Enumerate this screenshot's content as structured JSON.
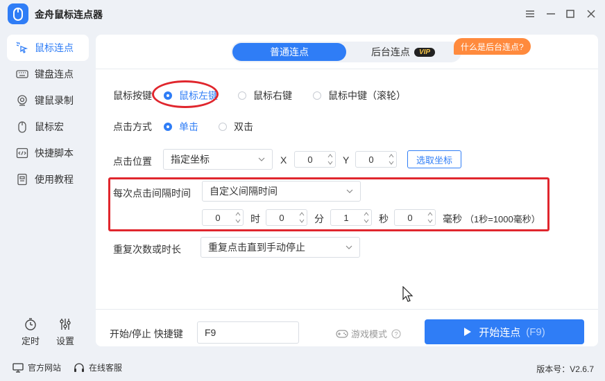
{
  "window": {
    "title": "金舟鼠标连点器",
    "controls": [
      "menu",
      "minimize",
      "maximize",
      "close"
    ]
  },
  "sidebar": {
    "items": [
      {
        "label": "鼠标连点",
        "icon": "mouse-click-icon",
        "active": true
      },
      {
        "label": "键盘连点",
        "icon": "keyboard-icon",
        "active": false
      },
      {
        "label": "键鼠录制",
        "icon": "record-icon",
        "active": false
      },
      {
        "label": "鼠标宏",
        "icon": "mouse-icon",
        "active": false
      },
      {
        "label": "快捷脚本",
        "icon": "script-icon",
        "active": false
      },
      {
        "label": "使用教程",
        "icon": "tutorial-icon",
        "active": false
      }
    ],
    "bottom": {
      "timer_label": "定时",
      "settings_label": "设置"
    }
  },
  "tabs": {
    "normal": "普通连点",
    "background": "后台连点",
    "vip_badge": "VIP",
    "help_bubble": "什么是后台连点?"
  },
  "form": {
    "mouse_button": {
      "label": "鼠标按键",
      "options": [
        "鼠标左键",
        "鼠标右键",
        "鼠标中键（滚轮）"
      ],
      "selected": "鼠标左键"
    },
    "click_type": {
      "label": "点击方式",
      "options": [
        "单击",
        "双击"
      ],
      "selected": "单击"
    },
    "position": {
      "label": "点击位置",
      "mode": "指定坐标",
      "x_label": "X",
      "x_value": "0",
      "y_label": "Y",
      "y_value": "0",
      "pick_button": "选取坐标"
    },
    "interval": {
      "label": "每次点击间隔时间",
      "mode": "自定义间隔时间",
      "hours": "0",
      "hours_unit": "时",
      "minutes": "0",
      "minutes_unit": "分",
      "seconds": "1",
      "seconds_unit": "秒",
      "ms": "0",
      "ms_unit": "毫秒",
      "note": "（1秒=1000毫秒）"
    },
    "repeat": {
      "label": "重复次数或时长",
      "mode": "重复点击直到手动停止"
    }
  },
  "footer": {
    "hotkey_label": "开始/停止 快捷键",
    "hotkey_value": "F9",
    "game_mode": "游戏模式",
    "start_button": "开始连点",
    "start_hotkey": "(F9)"
  },
  "statusbar": {
    "website": "官方网站",
    "service": "在线客服",
    "version": "版本号：V2.6.7"
  },
  "colors": {
    "accent": "#2f7df6",
    "annotation_red": "#e0262d",
    "bubble_orange": "#ff8a3d"
  }
}
